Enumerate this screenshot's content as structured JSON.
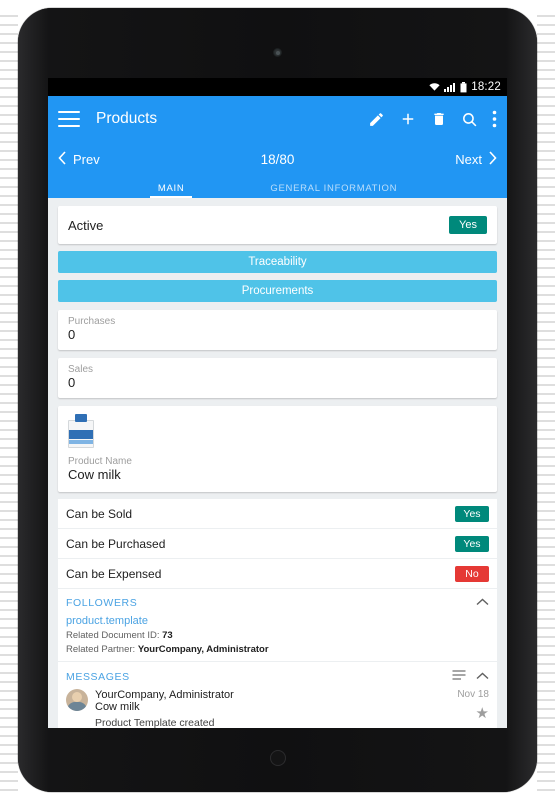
{
  "statusbar": {
    "wifi_icon": "wifi-icon",
    "signal_icon": "cellular-signal-icon",
    "battery_icon": "battery-icon",
    "time": "18:22"
  },
  "appbar": {
    "menu_icon": "hamburger-menu-icon",
    "title": "Products",
    "actions": [
      {
        "name": "edit-icon",
        "label": "Edit"
      },
      {
        "name": "add-icon",
        "label": "Add"
      },
      {
        "name": "delete-icon",
        "label": "Delete"
      },
      {
        "name": "search-icon",
        "label": "Search"
      },
      {
        "name": "more-vert-icon",
        "label": "More options"
      }
    ]
  },
  "navrow": {
    "prev_label": "Prev",
    "prev_icon": "chevron-left-icon",
    "counter": "18/80",
    "next_label": "Next",
    "next_icon": "chevron-right-icon"
  },
  "tabs": [
    {
      "label": "MAIN",
      "active": true
    },
    {
      "label": "GENERAL INFORMATION",
      "active": false
    }
  ],
  "form": {
    "active": {
      "label": "Active",
      "value": "Yes"
    },
    "buttons": [
      {
        "label": "Traceability"
      },
      {
        "label": "Procurements"
      }
    ],
    "purchases": {
      "label": "Purchases",
      "value": "0"
    },
    "sales": {
      "label": "Sales",
      "value": "0"
    },
    "product_name": {
      "label": "Product Name",
      "value": "Cow milk",
      "image_icon": "milk-carton-icon"
    },
    "toggles": [
      {
        "label": "Can be Sold",
        "value": "Yes",
        "state": "yes"
      },
      {
        "label": "Can be Purchased",
        "value": "Yes",
        "state": "yes"
      },
      {
        "label": "Can be Expensed",
        "value": "No",
        "state": "no"
      }
    ]
  },
  "followers": {
    "title": "FOLLOWERS",
    "collapse_icon": "chevron-up-icon",
    "link": "product.template",
    "related_document_label": "Related Document ID:",
    "related_document_value": "73",
    "related_partner_label": "Related Partner:",
    "related_partner_value": "YourCompany, Administrator"
  },
  "messages": {
    "title": "MESSAGES",
    "list_icon": "list-icon",
    "collapse_icon": "chevron-up-icon",
    "items": [
      {
        "avatar_icon": "user-avatar",
        "author": "YourCompany, Administrator",
        "subject": "Cow milk",
        "note": "Product Template created",
        "date": "Nov 18",
        "star_icon": "star-icon"
      }
    ]
  },
  "colors": {
    "primary": "#2196f3",
    "accent_button": "#4fc3e8",
    "yes": "#00897b",
    "no": "#e53935",
    "link": "#4ba3e3"
  }
}
